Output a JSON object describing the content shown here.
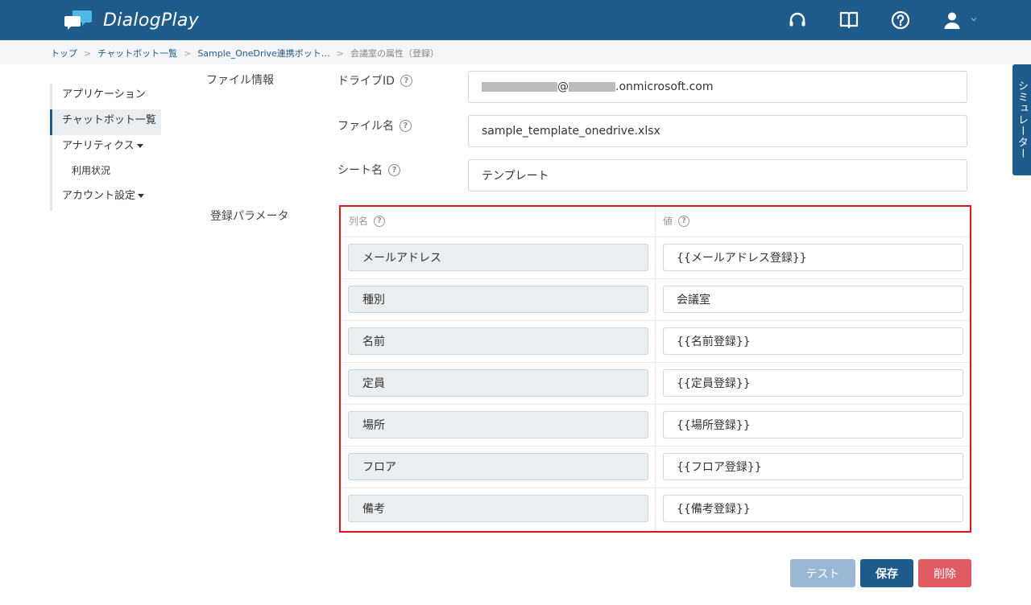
{
  "app": {
    "name": "DialogPlay"
  },
  "header": {
    "icons": [
      "headset-icon",
      "book-icon",
      "help-circle-icon",
      "user-icon"
    ]
  },
  "breadcrumb": {
    "items": [
      "トップ",
      "チャットボット一覧",
      "Sample_OneDrive連携ボット…"
    ],
    "current": "会議室の属性（登録）"
  },
  "sidebar": {
    "items": [
      {
        "label": "アプリケーション"
      },
      {
        "label": "チャットボット一覧",
        "active": true
      },
      {
        "label": "アナリティクス",
        "dropdown": true
      },
      {
        "label": "利用状況",
        "sub": true
      },
      {
        "label": "アカウント設定",
        "dropdown": true
      }
    ]
  },
  "file_info": {
    "section_label": "ファイル情報",
    "drive_id_label": "ドライブID",
    "drive_id_value_at": "@",
    "drive_id_value_domain": ".onmicrosoft.com",
    "file_name_label": "ファイル名",
    "file_name_value": "sample_template_onedrive.xlsx",
    "sheet_name_label": "シート名",
    "sheet_name_value": "テンプレート"
  },
  "params": {
    "section_label": "登録パラメータ",
    "col_name_header": "列名",
    "value_header": "値",
    "rows": [
      {
        "name": "メールアドレス",
        "value": "{{メールアドレス登録}}"
      },
      {
        "name": "種別",
        "value": "会議室"
      },
      {
        "name": "名前",
        "value": "{{名前登録}}"
      },
      {
        "name": "定員",
        "value": "{{定員登録}}"
      },
      {
        "name": "場所",
        "value": "{{場所登録}}"
      },
      {
        "name": "フロア",
        "value": "{{フロア登録}}"
      },
      {
        "name": "備考",
        "value": "{{備考登録}}"
      }
    ]
  },
  "buttons": {
    "test": "テスト",
    "save": "保存",
    "delete": "削除"
  },
  "simulator": {
    "label": "シミュレーター"
  },
  "colors": {
    "primary": "#1f5b8b",
    "highlight_border": "#e0141e",
    "delete": "#e05c62",
    "test": "#9ab7d3"
  },
  "help_glyph": "?"
}
